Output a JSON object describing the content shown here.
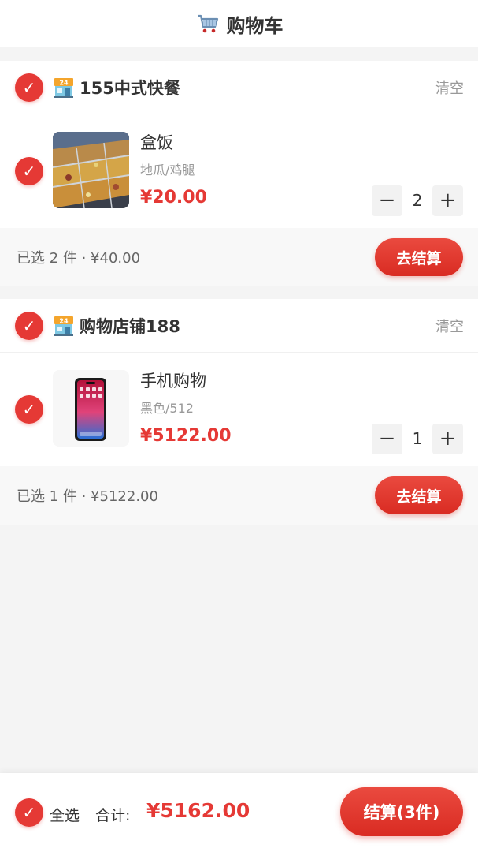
{
  "header": {
    "title": "购物车",
    "icon": "shopping-cart-icon"
  },
  "stores": [
    {
      "name": "155中式快餐",
      "icon": "convenience-store-icon",
      "clear_label": "清空",
      "selected": true,
      "items": [
        {
          "name": "盒饭",
          "spec": "地瓜/鸡腿",
          "price": "¥20.00",
          "quantity": "2",
          "image": "buffet-food-trays-photo",
          "selected": true
        }
      ],
      "summary": "已选 2 件 · ¥40.00",
      "checkout_label": "去结算"
    },
    {
      "name": "购物店铺188",
      "icon": "convenience-store-icon",
      "clear_label": "清空",
      "selected": true,
      "items": [
        {
          "name": "手机购物",
          "spec": "黑色/512",
          "price": "¥5122.00",
          "quantity": "1",
          "image": "smartphone-photo",
          "selected": true
        }
      ],
      "summary": "已选 1 件 · ¥5122.00",
      "checkout_label": "去结算"
    }
  ],
  "bottom_bar": {
    "select_all_label": "全选",
    "total_label": "合计:",
    "total_value": "¥5162.00",
    "checkout_label": "结算(3件)"
  },
  "controls": {
    "minus": "−",
    "plus": "+",
    "check_mark": "✓"
  },
  "colors": {
    "accent": "#e53935",
    "background": "#f4f4f4",
    "muted_text": "#999999"
  }
}
